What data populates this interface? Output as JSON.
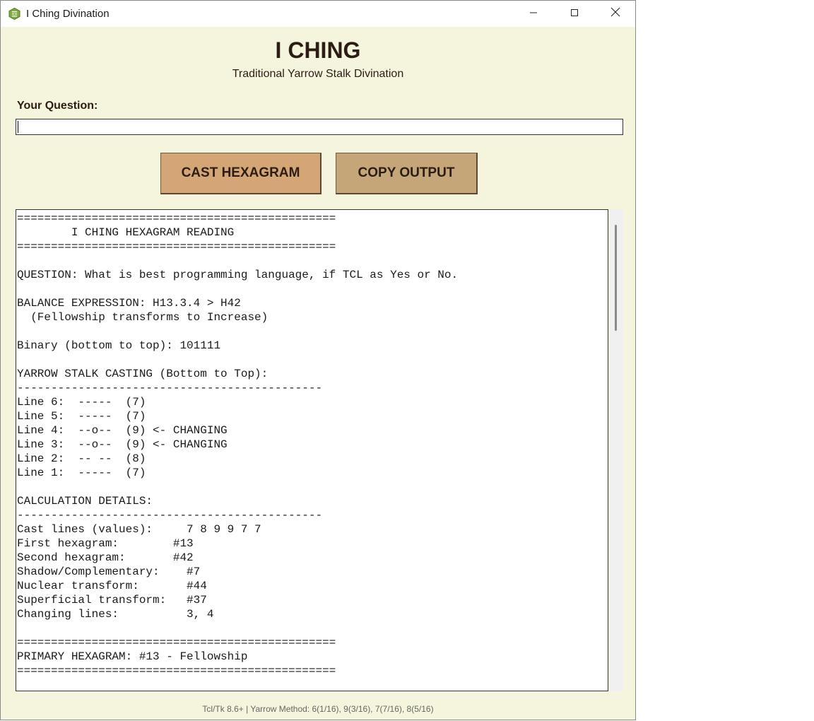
{
  "window": {
    "title": "I Ching Divination",
    "app_icon": "hexagram-app-icon",
    "controls": [
      "minimize-icon",
      "maximize-icon",
      "close-icon"
    ]
  },
  "header": {
    "title": "I CHING",
    "subtitle": "Traditional Yarrow Stalk Divination"
  },
  "question": {
    "label": "Your Question:",
    "value": "",
    "placeholder": ""
  },
  "buttons": {
    "cast_label": "CAST HEXAGRAM",
    "copy_label": "COPY OUTPUT"
  },
  "output": {
    "lines": [
      "===============================================",
      "        I CHING HEXAGRAM READING",
      "===============================================",
      "",
      "QUESTION: What is best programming language, if TCL as Yes or No.",
      "",
      "BALANCE EXPRESSION: H13.3.4 > H42",
      "  (Fellowship transforms to Increase)",
      "",
      "Binary (bottom to top): 101111",
      "",
      "YARROW STALK CASTING (Bottom to Top):",
      "---------------------------------------------",
      "Line 6:  -----  (7)",
      "Line 5:  -----  (7)",
      "Line 4:  --o--  (9) <- CHANGING",
      "Line 3:  --o--  (9) <- CHANGING",
      "Line 2:  -- --  (8)",
      "Line 1:  -----  (7)",
      "",
      "CALCULATION DETAILS:",
      "---------------------------------------------",
      "Cast lines (values):     7 8 9 9 7 7",
      "First hexagram:        #13",
      "Second hexagram:       #42",
      "Shadow/Complementary:    #7",
      "Nuclear transform:       #44",
      "Superficial transform:   #37",
      "Changing lines:          3, 4",
      "",
      "===============================================",
      "PRIMARY HEXAGRAM: #13 - Fellowship",
      "==============================================="
    ]
  },
  "footer": {
    "text": "Tcl/Tk 8.6+ | Yarrow Method: 6(1/16), 9(3/16), 7(7/16), 8(5/16)"
  },
  "colors": {
    "background": "#f5f4dc",
    "cast_button": "#d5a675",
    "copy_button": "#c4a679",
    "text": "#2b1d14"
  }
}
